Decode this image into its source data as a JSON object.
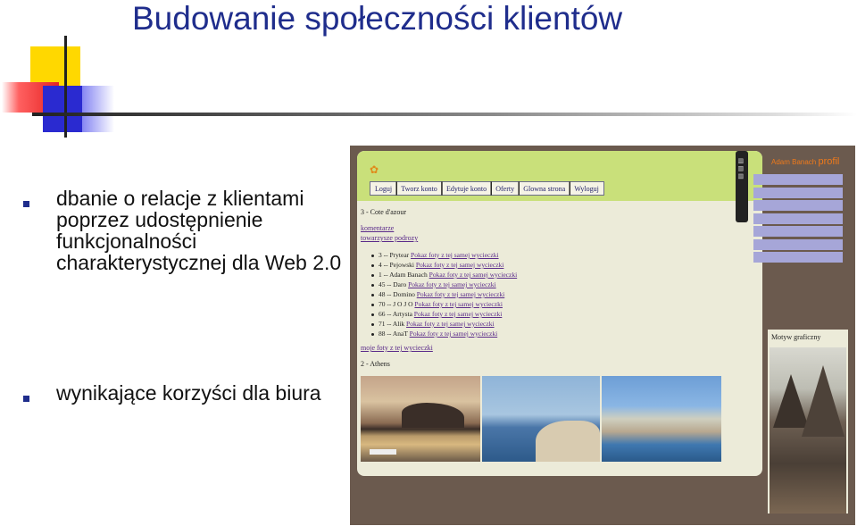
{
  "slide": {
    "title": "Budowanie społeczności klientów",
    "bullets": [
      "dbanie o relacje z klientami poprzez udostępnienie funkcjonalności charakterystycznej dla Web 2.0",
      "wynikające korzyści dla biura"
    ]
  },
  "screenshot": {
    "nav": [
      "Loguj",
      "Tworz konto",
      "Edytuje konto",
      "Oferty",
      "Glowna strona",
      "Wyloguj"
    ],
    "trip_title": "3 - Cote d'azour",
    "link_comments": "komentarze",
    "link_companions": "towarzysze podrozy",
    "entries": [
      {
        "label": "3 -- Prytear",
        "link": "Pokaz foty z tej samej wycieczki"
      },
      {
        "label": "4 -- Pejowski",
        "link": "Pokaz foty z tej samej wycieczki"
      },
      {
        "label": "1 -- Adam Banach",
        "link": "Pokaz foty z tej samej wycieczki"
      },
      {
        "label": "45 -- Daro",
        "link": "Pokaz foty z tej samej wycieczki"
      },
      {
        "label": "48 -- Domino",
        "link": "Pokaz foty z tej samej wycieczki"
      },
      {
        "label": "70 -- J O J O",
        "link": "Pokaz foty z tej samej wycieczki"
      },
      {
        "label": "66 -- Artysta",
        "link": "Pokaz foty z tej samej wycieczki"
      },
      {
        "label": "71 -- Alik",
        "link": "Pokaz foty z tej samej wycieczki"
      },
      {
        "label": "88 -- AnaT",
        "link": "Pokaz foty z tej samej wycieczki"
      }
    ],
    "my_photos_link": "moje foty z tej wycieczki",
    "second_trip": "2 - Athens",
    "profile_owner": "Adam Banach",
    "profile_word": "profil",
    "motif_label": "Motyw graficzny"
  },
  "colors": {
    "title": "#1f2d8c",
    "panel_bg": "#6b5a4e",
    "header_green": "#c9e07a",
    "menu_purple": "#a6a6d8"
  }
}
